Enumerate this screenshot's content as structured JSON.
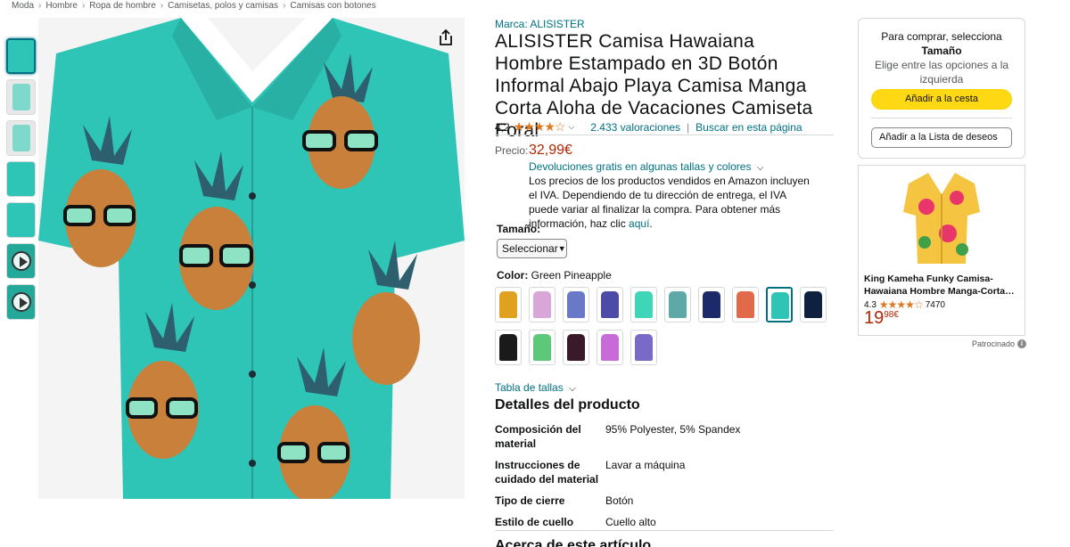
{
  "breadcrumb": [
    "Moda",
    "Hombre",
    "Ropa de hombre",
    "Camisetas, polos y camisas",
    "Camisas con botones"
  ],
  "breadcrumb_separator": "›",
  "product": {
    "brand": "Marca: ALISISTER",
    "title": "ALISISTER Camisa Hawaiana Hombre Estampado en 3D Botón Informal Abajo Playa Camisa Manga Corta Aloha de Vacaciones Camiseta Foral",
    "rating_value": "4,2",
    "rating_stars": 4.2,
    "ratings_count": "2.433 valoraciones",
    "search_page": "Buscar en esta página",
    "price_label": "Precio:",
    "price": "32,99€",
    "returns": "Devoluciones gratis en algunas tallas y colores",
    "tax_info": "Los precios de los productos vendidos en Amazon incluyen el IVA. Dependiendo de tu dirección de entrega, el IVA puede variar al finalizar la compra. Para obtener más información, haz clic ",
    "tax_link": "aquí",
    "size_label": "Tamaño:",
    "size_select": "Seleccionar",
    "color_label": "Color:",
    "color_value": "Green Pineapple",
    "size_table": "Tabla de tallas",
    "details_title": "Detalles del producto",
    "details": [
      {
        "key": "Composición del material",
        "value": "95% Polyester, 5% Spandex"
      },
      {
        "key": "Instrucciones de cuidado del material",
        "value": "Lavar a máquina"
      },
      {
        "key": "Tipo de cierre",
        "value": "Botón"
      },
      {
        "key": "Estilo de cuello",
        "value": "Cuello alto"
      }
    ],
    "next_heading": "Acerca de este artículo"
  },
  "swatch_colors": [
    "#e0a020",
    "#d8a6d8",
    "#6a78c8",
    "#4c4ca8",
    "#3fd6b8",
    "#5fa8a8",
    "#1c2a6a",
    "#e06a4a",
    "#2ec4b6",
    "#102040",
    "#1a1a1a",
    "#5ec87a",
    "#3a1a2a",
    "#c86ad8",
    "#7a6ac8"
  ],
  "selected_swatch": 8,
  "buybox": {
    "message_1": "Para comprar, selecciona",
    "message_2": "Tamaño",
    "message_3": "Elige entre las opciones a la izquierda",
    "cart_button": "Añadir a la cesta",
    "wishlist_button": "Añadir a la Lista de deseos"
  },
  "ad": {
    "title": "King Kameha Funky Camisa-Hawaiana Hombre Manga-Corta…",
    "rating": "4.3",
    "reviews": "7470",
    "price_whole": "19",
    "price_fraction": "98",
    "price_currency": "€",
    "sponsored": "Patrocinado"
  },
  "colors": {
    "link": "#007185",
    "price": "#b12704",
    "cart_button": "#ffd814",
    "star": "#de7921",
    "shirt": "#2ec4b6"
  }
}
